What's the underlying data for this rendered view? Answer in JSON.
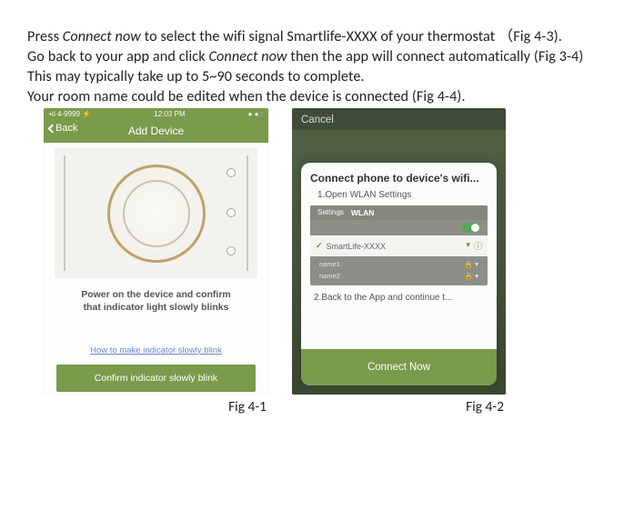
{
  "instructions": {
    "line1_pre": "Press ",
    "line1_em": "Connect now",
    "line1_post": " to select the wifi signal Smartlife-XXXX of your thermostat （Fig 4-3).",
    "line2_pre": "Go back to your app and click ",
    "line2_em": "Connect now",
    "line2_post": " then the app will connect automatically (Fig 3-4)",
    "line3": "This may typically take up to 5~90 seconds to complete.",
    "line4": "Your room name could be edited when the device is connected (Fig 4-4)."
  },
  "fig1": {
    "caption": "Fig 4-1",
    "status_left": "•ıl 4-9999 ⚡",
    "status_time": "12:03 PM",
    "status_right": "● ● :",
    "back": "Back",
    "title": "Add Device",
    "prompt1": "Power on the device and confirm",
    "prompt2": "that indicator light slowly blinks",
    "help_link": "How to make indicator slowly blink",
    "cta": "Confirm indicator slowly blink"
  },
  "fig2": {
    "caption": "Fig 4-2",
    "cancel": "Cancel",
    "card_title": "Connect phone to device's wifi...",
    "step1": "1.Open WLAN Settings",
    "wlan_settings": "Settings",
    "wlan_label": "WLAN",
    "selected_ssid": "SmartLife-XXXX",
    "other1": "name1",
    "other2": "name2",
    "step2": "2.Back to the App and continue t...",
    "cta": "Connect Now"
  }
}
